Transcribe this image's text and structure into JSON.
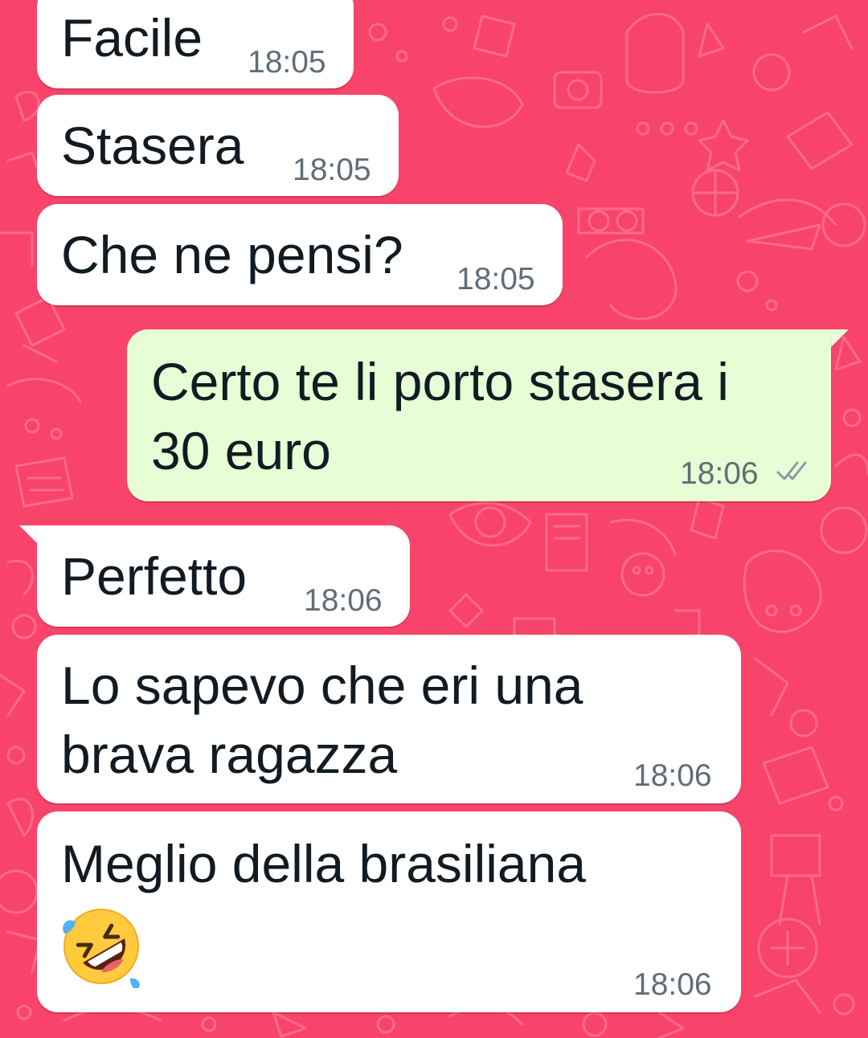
{
  "colors": {
    "background": "#f8446a",
    "incoming_bubble": "#ffffff",
    "outgoing_bubble": "#e6fdd5",
    "timestamp": "#5f6e76",
    "read_ticks": "#8a9aa2"
  },
  "messages": [
    {
      "direction": "incoming",
      "text": "Facile",
      "time": "18:05"
    },
    {
      "direction": "incoming",
      "text": "Stasera",
      "time": "18:05"
    },
    {
      "direction": "incoming",
      "text": "Che ne pensi?",
      "time": "18:05"
    },
    {
      "direction": "outgoing",
      "lines": [
        "Certo te li porto stasera i",
        "30 euro"
      ],
      "time": "18:06",
      "status_icon": "double-check-icon"
    },
    {
      "direction": "incoming",
      "text": "Perfetto",
      "time": "18:06"
    },
    {
      "direction": "incoming",
      "lines": [
        "Lo sapevo che eri una",
        "brava ragazza"
      ],
      "time": "18:06"
    },
    {
      "direction": "incoming",
      "text": "Meglio della brasiliana",
      "emoji": "rolling-on-the-floor-laughing-emoji",
      "time": "18:06"
    }
  ]
}
